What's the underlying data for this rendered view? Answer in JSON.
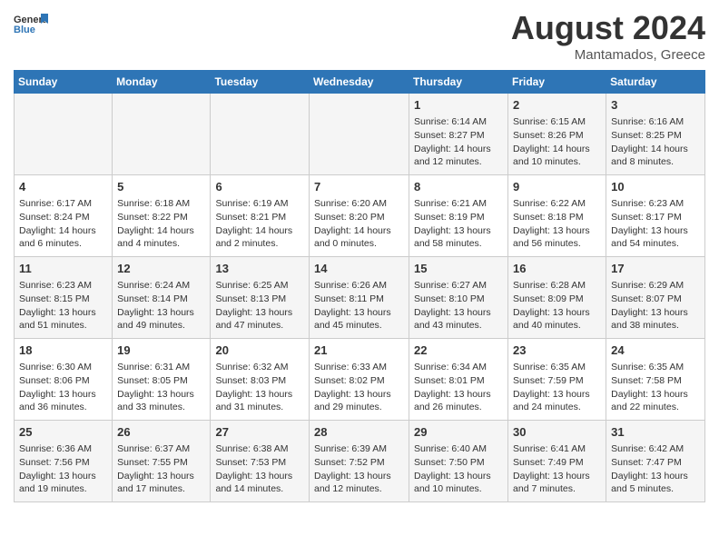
{
  "header": {
    "logo_line1": "General",
    "logo_line2": "Blue",
    "month_year": "August 2024",
    "location": "Mantamados, Greece"
  },
  "weekdays": [
    "Sunday",
    "Monday",
    "Tuesday",
    "Wednesday",
    "Thursday",
    "Friday",
    "Saturday"
  ],
  "weeks": [
    [
      {
        "num": "",
        "info": ""
      },
      {
        "num": "",
        "info": ""
      },
      {
        "num": "",
        "info": ""
      },
      {
        "num": "",
        "info": ""
      },
      {
        "num": "1",
        "info": "Sunrise: 6:14 AM\nSunset: 8:27 PM\nDaylight: 14 hours\nand 12 minutes."
      },
      {
        "num": "2",
        "info": "Sunrise: 6:15 AM\nSunset: 8:26 PM\nDaylight: 14 hours\nand 10 minutes."
      },
      {
        "num": "3",
        "info": "Sunrise: 6:16 AM\nSunset: 8:25 PM\nDaylight: 14 hours\nand 8 minutes."
      }
    ],
    [
      {
        "num": "4",
        "info": "Sunrise: 6:17 AM\nSunset: 8:24 PM\nDaylight: 14 hours\nand 6 minutes."
      },
      {
        "num": "5",
        "info": "Sunrise: 6:18 AM\nSunset: 8:22 PM\nDaylight: 14 hours\nand 4 minutes."
      },
      {
        "num": "6",
        "info": "Sunrise: 6:19 AM\nSunset: 8:21 PM\nDaylight: 14 hours\nand 2 minutes."
      },
      {
        "num": "7",
        "info": "Sunrise: 6:20 AM\nSunset: 8:20 PM\nDaylight: 14 hours\nand 0 minutes."
      },
      {
        "num": "8",
        "info": "Sunrise: 6:21 AM\nSunset: 8:19 PM\nDaylight: 13 hours\nand 58 minutes."
      },
      {
        "num": "9",
        "info": "Sunrise: 6:22 AM\nSunset: 8:18 PM\nDaylight: 13 hours\nand 56 minutes."
      },
      {
        "num": "10",
        "info": "Sunrise: 6:23 AM\nSunset: 8:17 PM\nDaylight: 13 hours\nand 54 minutes."
      }
    ],
    [
      {
        "num": "11",
        "info": "Sunrise: 6:23 AM\nSunset: 8:15 PM\nDaylight: 13 hours\nand 51 minutes."
      },
      {
        "num": "12",
        "info": "Sunrise: 6:24 AM\nSunset: 8:14 PM\nDaylight: 13 hours\nand 49 minutes."
      },
      {
        "num": "13",
        "info": "Sunrise: 6:25 AM\nSunset: 8:13 PM\nDaylight: 13 hours\nand 47 minutes."
      },
      {
        "num": "14",
        "info": "Sunrise: 6:26 AM\nSunset: 8:11 PM\nDaylight: 13 hours\nand 45 minutes."
      },
      {
        "num": "15",
        "info": "Sunrise: 6:27 AM\nSunset: 8:10 PM\nDaylight: 13 hours\nand 43 minutes."
      },
      {
        "num": "16",
        "info": "Sunrise: 6:28 AM\nSunset: 8:09 PM\nDaylight: 13 hours\nand 40 minutes."
      },
      {
        "num": "17",
        "info": "Sunrise: 6:29 AM\nSunset: 8:07 PM\nDaylight: 13 hours\nand 38 minutes."
      }
    ],
    [
      {
        "num": "18",
        "info": "Sunrise: 6:30 AM\nSunset: 8:06 PM\nDaylight: 13 hours\nand 36 minutes."
      },
      {
        "num": "19",
        "info": "Sunrise: 6:31 AM\nSunset: 8:05 PM\nDaylight: 13 hours\nand 33 minutes."
      },
      {
        "num": "20",
        "info": "Sunrise: 6:32 AM\nSunset: 8:03 PM\nDaylight: 13 hours\nand 31 minutes."
      },
      {
        "num": "21",
        "info": "Sunrise: 6:33 AM\nSunset: 8:02 PM\nDaylight: 13 hours\nand 29 minutes."
      },
      {
        "num": "22",
        "info": "Sunrise: 6:34 AM\nSunset: 8:01 PM\nDaylight: 13 hours\nand 26 minutes."
      },
      {
        "num": "23",
        "info": "Sunrise: 6:35 AM\nSunset: 7:59 PM\nDaylight: 13 hours\nand 24 minutes."
      },
      {
        "num": "24",
        "info": "Sunrise: 6:35 AM\nSunset: 7:58 PM\nDaylight: 13 hours\nand 22 minutes."
      }
    ],
    [
      {
        "num": "25",
        "info": "Sunrise: 6:36 AM\nSunset: 7:56 PM\nDaylight: 13 hours\nand 19 minutes."
      },
      {
        "num": "26",
        "info": "Sunrise: 6:37 AM\nSunset: 7:55 PM\nDaylight: 13 hours\nand 17 minutes."
      },
      {
        "num": "27",
        "info": "Sunrise: 6:38 AM\nSunset: 7:53 PM\nDaylight: 13 hours\nand 14 minutes."
      },
      {
        "num": "28",
        "info": "Sunrise: 6:39 AM\nSunset: 7:52 PM\nDaylight: 13 hours\nand 12 minutes."
      },
      {
        "num": "29",
        "info": "Sunrise: 6:40 AM\nSunset: 7:50 PM\nDaylight: 13 hours\nand 10 minutes."
      },
      {
        "num": "30",
        "info": "Sunrise: 6:41 AM\nSunset: 7:49 PM\nDaylight: 13 hours\nand 7 minutes."
      },
      {
        "num": "31",
        "info": "Sunrise: 6:42 AM\nSunset: 7:47 PM\nDaylight: 13 hours\nand 5 minutes."
      }
    ]
  ]
}
